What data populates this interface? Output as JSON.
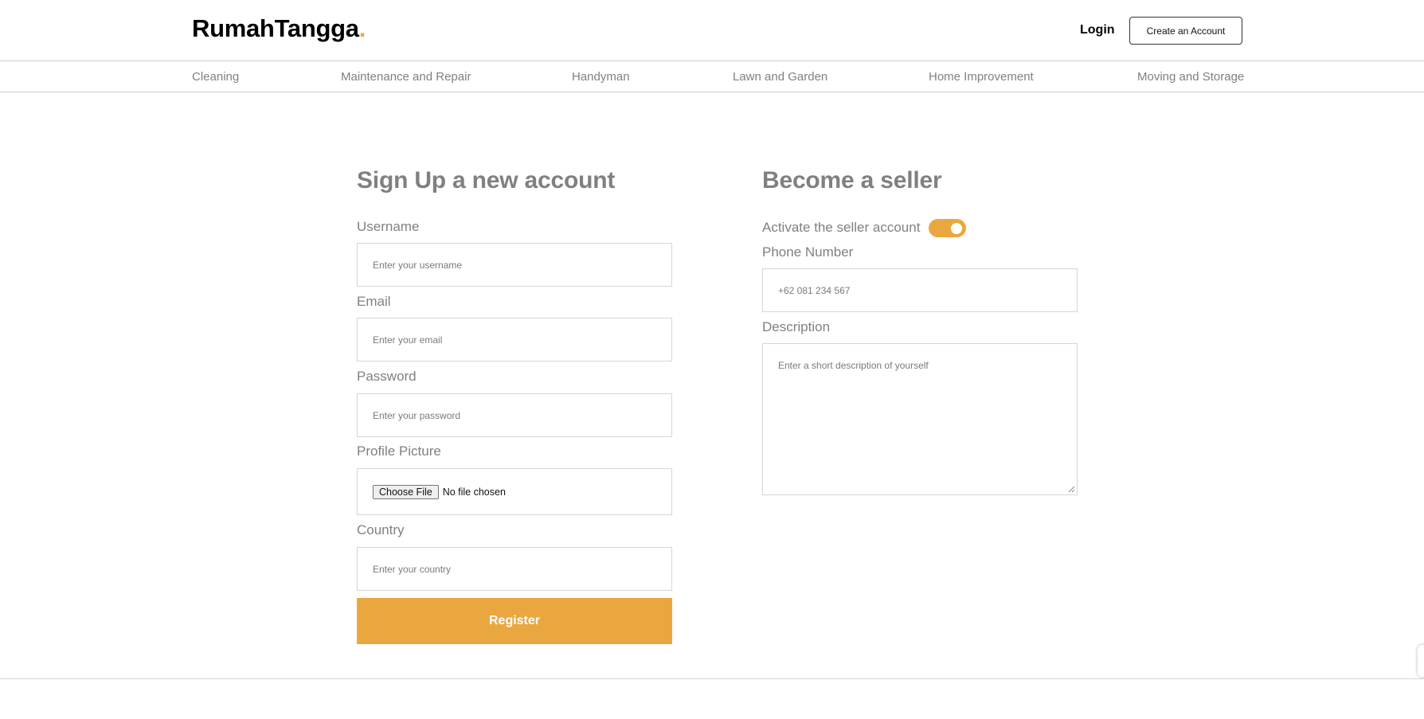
{
  "header": {
    "logo_text": "RumahTangga",
    "logo_dot": ".",
    "login_label": "Login",
    "create_account_label": "Create an Account"
  },
  "categories": [
    "Cleaning",
    "Maintenance and Repair",
    "Handyman",
    "Lawn and Garden",
    "Home Improvement",
    "Moving and Storage"
  ],
  "signup": {
    "title": "Sign Up a new account",
    "username_label": "Username",
    "username_placeholder": "Enter your username",
    "email_label": "Email",
    "email_placeholder": "Enter your email",
    "password_label": "Password",
    "password_placeholder": "Enter your password",
    "picture_label": "Profile Picture",
    "choose_file_label": "Choose File",
    "no_file_text": "No file chosen",
    "country_label": "Country",
    "country_placeholder": "Enter your country",
    "register_label": "Register"
  },
  "seller": {
    "title": "Become a seller",
    "activate_label": "Activate the seller account",
    "activate_on": true,
    "phone_label": "Phone Number",
    "phone_placeholder": "+62 081 234 567",
    "description_label": "Description",
    "description_placeholder": "Enter a short description of yourself"
  },
  "colors": {
    "accent": "#eba73f",
    "muted_text": "#808080",
    "border": "#d6d6d6"
  }
}
